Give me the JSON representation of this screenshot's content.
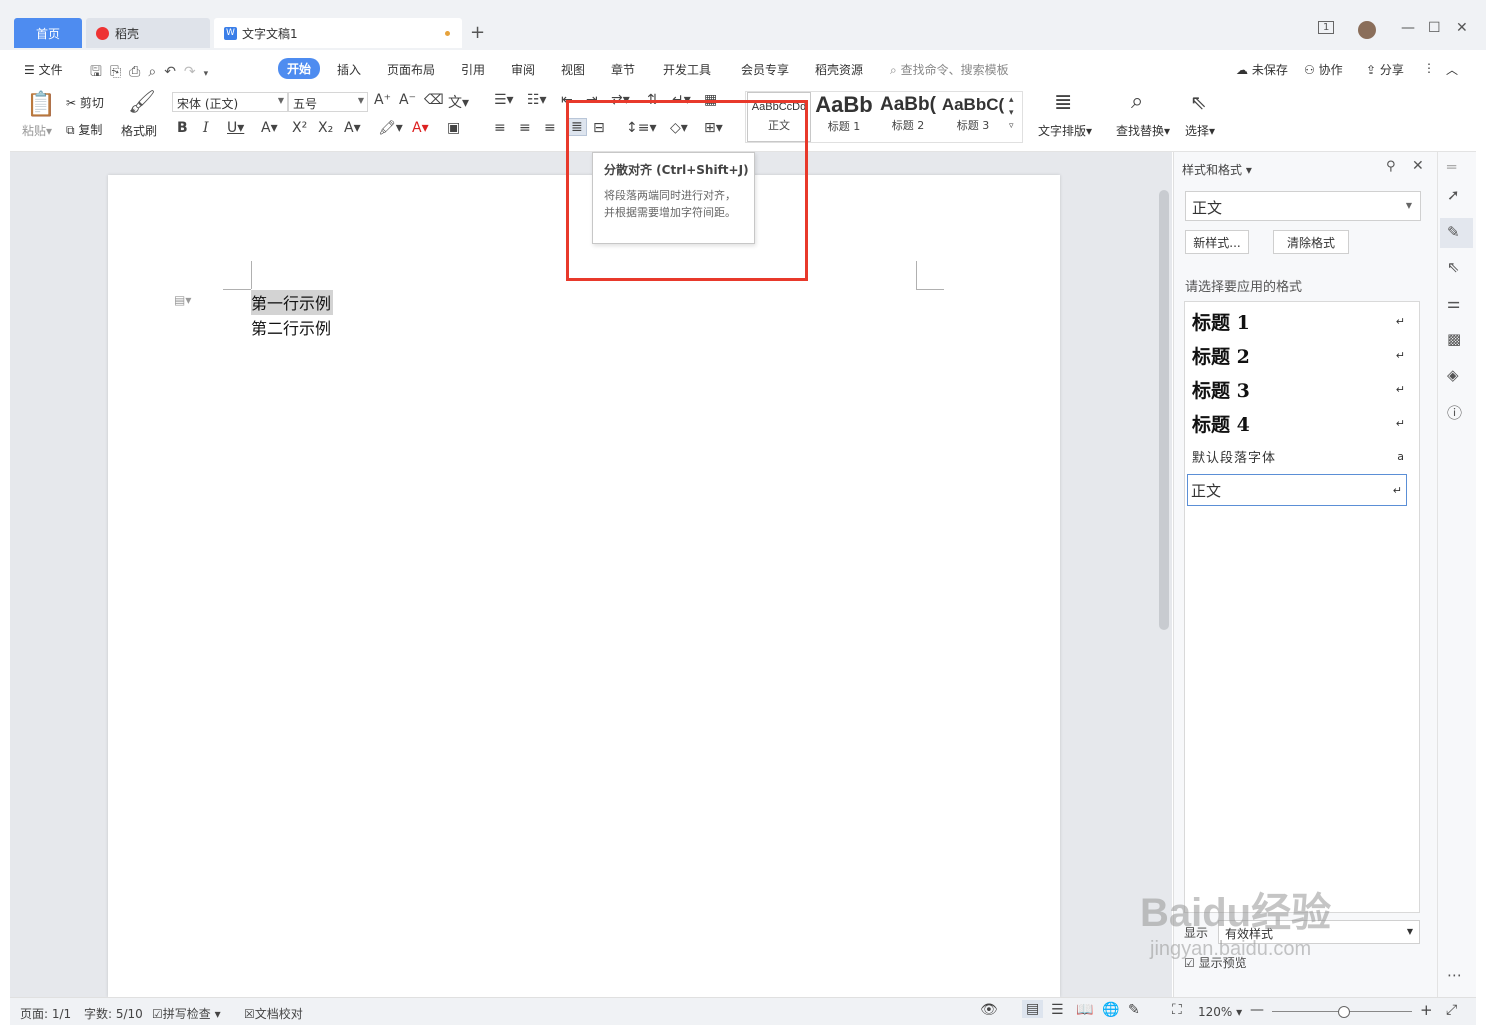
{
  "window": {
    "tabs": [
      {
        "label": "首页"
      },
      {
        "label": "稻壳"
      },
      {
        "label": "文字文稿1"
      }
    ],
    "add_tab": "+",
    "controls": [
      "1",
      "—",
      "☐",
      "✕"
    ]
  },
  "menu": {
    "file": "文件",
    "items": [
      "开始",
      "插入",
      "页面布局",
      "引用",
      "审阅",
      "视图",
      "章节",
      "开发工具",
      "会员专享",
      "稻壳资源"
    ],
    "search_placeholder": "查找命令、搜索模板",
    "right": [
      "未保存",
      "协作",
      "分享"
    ]
  },
  "ribbon": {
    "paste": "粘贴",
    "cut": "剪切",
    "copy": "复制",
    "format_painter": "格式刷",
    "font_name": "宋体 (正文)",
    "font_size": "五号",
    "styles": [
      {
        "preview": "AaBbCcDd",
        "label": "正文"
      },
      {
        "preview": "AaBb",
        "label": "标题 1"
      },
      {
        "preview": "AaBb(",
        "label": "标题 2"
      },
      {
        "preview": "AaBbC(",
        "label": "标题 3"
      }
    ],
    "text_layout": "文字排版",
    "find_replace": "查找替换",
    "select": "选择"
  },
  "tooltip": {
    "title": "分散对齐 (Ctrl+Shift+J)",
    "description": "将段落两端同时进行对齐，并根据需要增加字符间距。"
  },
  "document": {
    "line1": "第一行示例",
    "line2": "第二行示例"
  },
  "panel": {
    "title": "样式和格式",
    "current_style": "正文",
    "new_style": "新样式...",
    "clear_format": "清除格式",
    "apply_label": "请选择要应用的格式",
    "styles": [
      {
        "label": "标题  1"
      },
      {
        "label": "标题  2"
      },
      {
        "label": "标题  3"
      },
      {
        "label": "标题  4"
      },
      {
        "label": "默认段落字体"
      },
      {
        "label": "正文"
      }
    ],
    "show_label": "显示",
    "show_value": "有效样式",
    "preview_label": "显示预览"
  },
  "status": {
    "page": "页面: 1/1",
    "words": "字数: 5/10",
    "spell": "拼写检查",
    "proofread": "文档校对",
    "zoom": "120%"
  },
  "watermark": {
    "line1": "Baidu经验",
    "line2": "jingyan.baidu.com"
  },
  "colors": {
    "accent": "#4e8cf0",
    "highlight_box": "#e8392b"
  }
}
